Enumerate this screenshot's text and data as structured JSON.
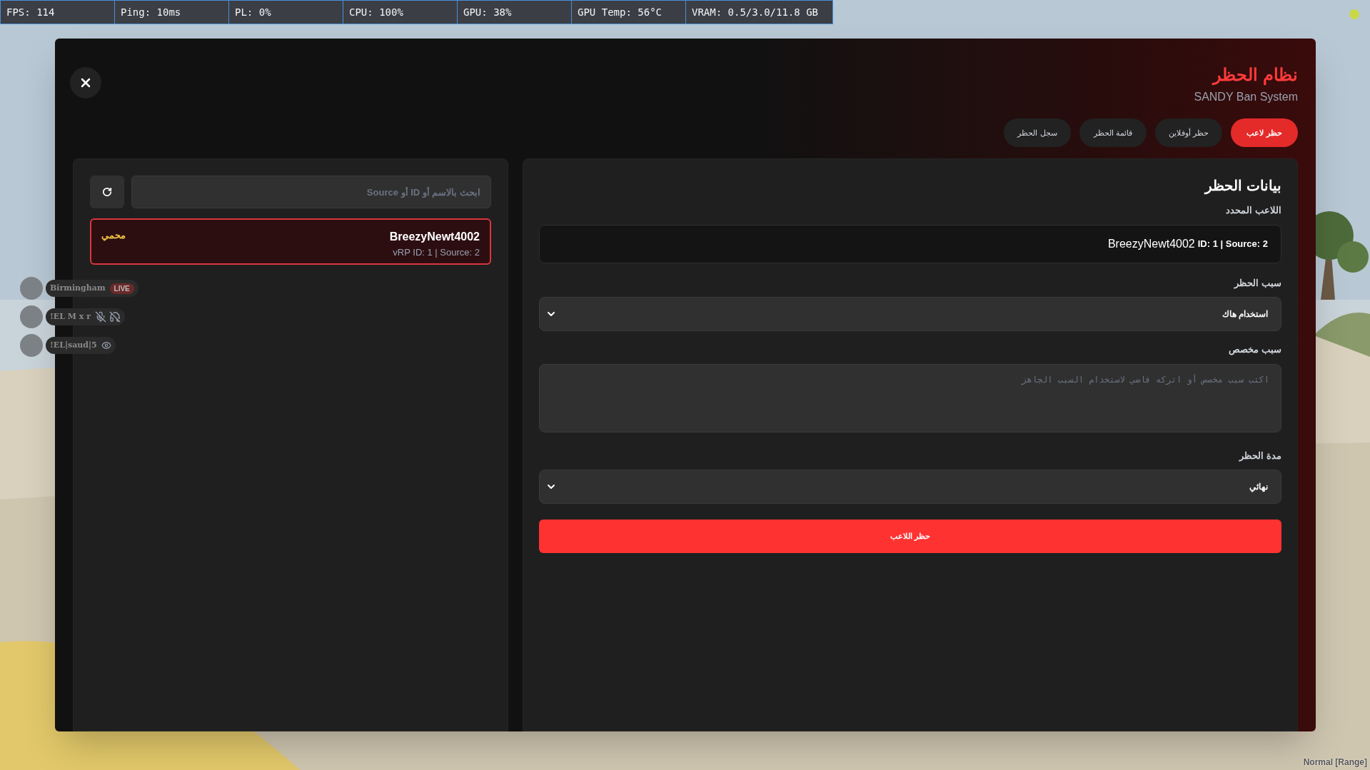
{
  "stats_bar": {
    "fps": "FPS: 114",
    "ping": "Ping: 10ms",
    "packet_loss": "PL: 0%",
    "cpu": "CPU: 100%",
    "gpu": "GPU: 38%",
    "gpu_temp": "GPU Temp: 56°C",
    "vram": "VRAM: 0.5/3.0/11.8 GB"
  },
  "modal": {
    "title": "نظام الحظر",
    "subtitle": "SANDY Ban System",
    "tabs": [
      {
        "label": "حظر لاعب",
        "selected": true
      },
      {
        "label": "حظر أوفلاين",
        "selected": false
      },
      {
        "label": "قائمة الحظر",
        "selected": false
      },
      {
        "label": "سجل الحظر",
        "selected": false
      }
    ],
    "player_list": {
      "search": {
        "placeholder": "ابحث بالاسم أو ID أو Source"
      },
      "players": [
        {
          "name": "BreezyNewt4002",
          "details": "vRP ID: 1 | Source: 2",
          "badge": "محمي",
          "selected": true
        }
      ]
    },
    "ban_form": {
      "heading": "بيانات الحظر",
      "fields": [
        {
          "kind": "display",
          "label": "اللاعب المحدد",
          "name": "BreezyNewt4002",
          "details": "ID: 1 | Source: 2"
        },
        {
          "kind": "select",
          "label": "سبب الحظر",
          "value": "استخدام هاك"
        },
        {
          "kind": "textarea",
          "label": "سبب مخصص",
          "placeholder": "اكتب سبب مخصص أو اتركه فاضي لاستخدام السبب الجاهز"
        },
        {
          "kind": "select",
          "label": "مدة الحظر",
          "value": "نهائي"
        }
      ],
      "submit": "حظر اللاعب"
    }
  },
  "voice_list": [
    {
      "name": "Birmingham",
      "kind": "live",
      "badge": "LIVE"
    },
    {
      "name": "!EL M x r",
      "kind": "muted"
    },
    {
      "name": "!EL|saud|5",
      "kind": "watching"
    }
  ],
  "mode_label": "Normal [Range]"
}
